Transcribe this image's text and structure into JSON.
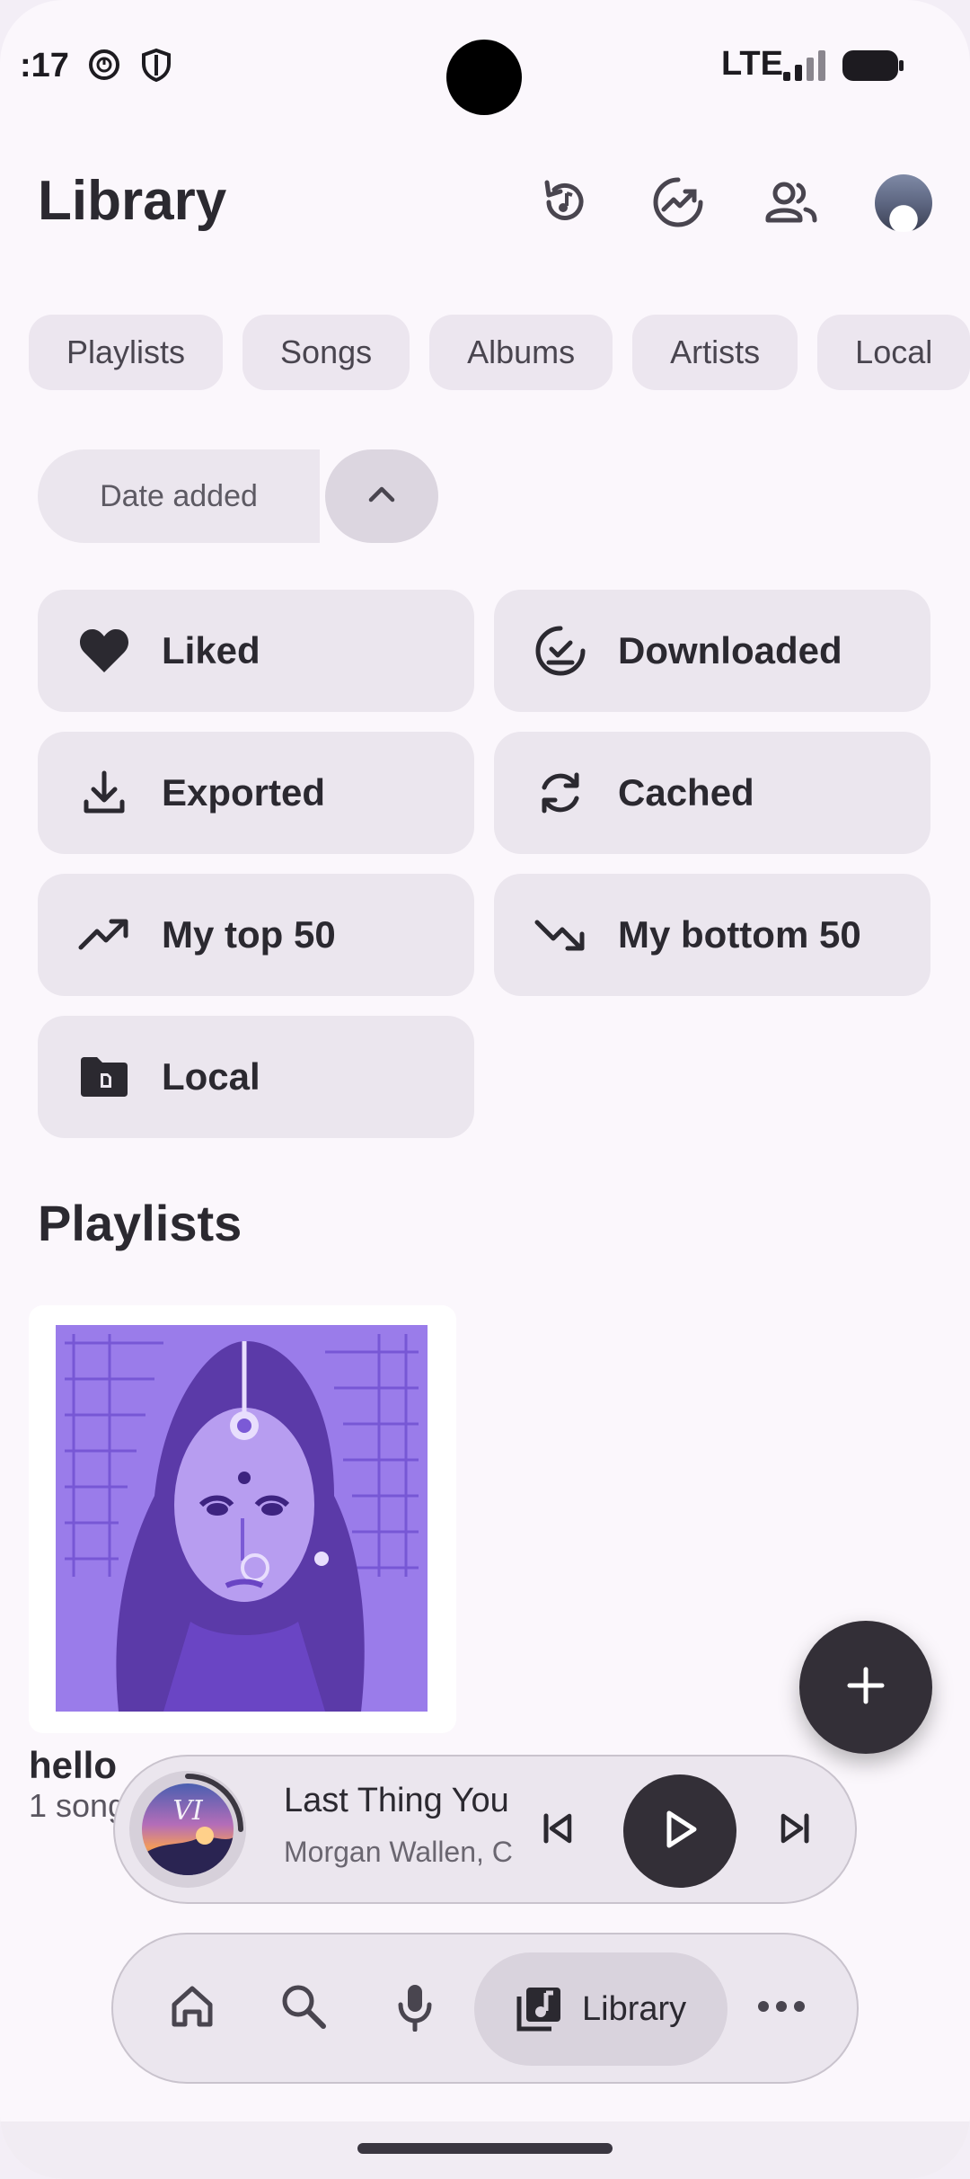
{
  "status_bar": {
    "time": ":17",
    "network": "LTE"
  },
  "header": {
    "title": "Library"
  },
  "filter_chips": [
    {
      "label": "Playlists"
    },
    {
      "label": "Songs"
    },
    {
      "label": "Albums"
    },
    {
      "label": "Artists"
    },
    {
      "label": "Local"
    }
  ],
  "sort": {
    "label": "Date added"
  },
  "collections": [
    {
      "label": "Liked",
      "icon": "heart-icon"
    },
    {
      "label": "Downloaded",
      "icon": "download-check-icon"
    },
    {
      "label": "Exported",
      "icon": "export-download-icon"
    },
    {
      "label": "Cached",
      "icon": "cache-sync-icon"
    },
    {
      "label": "My top 50",
      "icon": "trending-up-icon"
    },
    {
      "label": "My bottom 50",
      "icon": "trending-down-icon"
    },
    {
      "label": "Local",
      "icon": "local-folder-icon"
    }
  ],
  "playlists_section": {
    "title": "Playlists",
    "items": [
      {
        "name": "hello",
        "count": "1 song"
      }
    ]
  },
  "mini_player": {
    "title": "Last Thing You",
    "artist": "Morgan Wallen, C"
  },
  "bottom_nav": {
    "library_label": "Library"
  },
  "colors": {
    "background": "#fbf7fc",
    "surface": "#ebe6ee",
    "accent_dark": "#332f37",
    "playlist_art": "#8e6fe0"
  }
}
